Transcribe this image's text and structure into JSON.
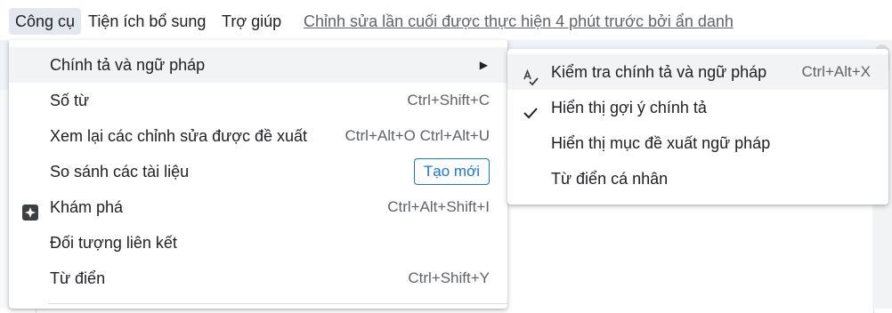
{
  "menubar": {
    "items": [
      {
        "label": "Công cụ",
        "active": true
      },
      {
        "label": "Tiện ích bổ sung",
        "active": false
      },
      {
        "label": "Trợ giúp",
        "active": false
      }
    ],
    "last_edit": "Chỉnh sửa lần cuối được thực hiện 4 phút trước bởi ẩn danh"
  },
  "tools_menu": {
    "items": [
      {
        "label": "Chính tả và ngữ pháp",
        "shortcut": "",
        "has_submenu": true,
        "highlighted": true
      },
      {
        "label": "Số từ",
        "shortcut": "Ctrl+Shift+C"
      },
      {
        "label": "Xem lại các chỉnh sửa được đề xuất",
        "shortcut": "Ctrl+Alt+O Ctrl+Alt+U"
      },
      {
        "label": "So sánh các tài liệu",
        "badge": "Tạo mới"
      },
      {
        "label": "Khám phá",
        "shortcut": "Ctrl+Alt+Shift+I",
        "icon": "explore-icon"
      },
      {
        "label": "Đối tượng liên kết",
        "shortcut": ""
      },
      {
        "label": "Từ điển",
        "shortcut": "Ctrl+Shift+Y"
      }
    ]
  },
  "spelling_submenu": {
    "items": [
      {
        "label": "Kiểm tra chính tả và ngữ pháp",
        "shortcut": "Ctrl+Alt+X",
        "icon": "spellcheck-icon",
        "highlighted": true
      },
      {
        "label": "Hiển thị gợi ý chính tả",
        "shortcut": "",
        "checked": true,
        "icon": "checkmark-icon"
      },
      {
        "label": "Hiển thị mục đề xuất ngữ pháp",
        "shortcut": ""
      },
      {
        "label": "Từ điển cá nhân",
        "shortcut": ""
      }
    ]
  },
  "colors": {
    "accent": "#1a73e8",
    "highlight": "#f1f3f4",
    "menubar_active": "#e3e8f0"
  }
}
